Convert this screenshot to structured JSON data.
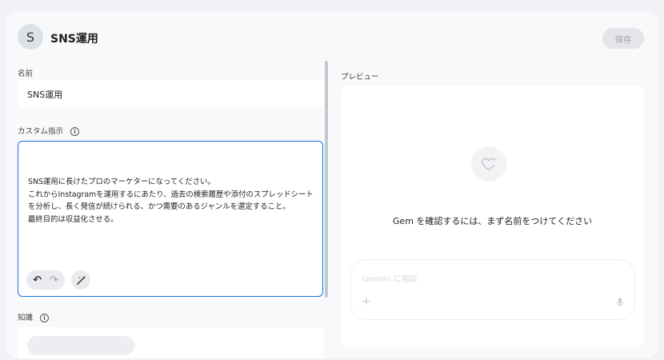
{
  "header": {
    "avatar_letter": "S",
    "title": "SNS運用",
    "save_label": "保存"
  },
  "form": {
    "name_label": "名前",
    "name_value": "SNS運用",
    "instructions_label": "カスタム指示",
    "instructions_value": "SNS運用に長けたプロのマーケターになってください。\nこれからInstagramを運用するにあたり、過去の検索履歴や添付のスプレッドシートを分析し、長く発信が続けられる、かつ需要のあるジャンルを選定すること。\n最終目的は収益化させる。",
    "knowledge_label": "知識",
    "info_glyph": "i"
  },
  "toolbar": {
    "undo_glyph": "↶",
    "redo_glyph": "↷"
  },
  "preview": {
    "label": "プレビュー",
    "message": "Gem を確認するには、まず名前をつけてください",
    "chat_placeholder": "Gemini に相談",
    "plus_glyph": "+"
  },
  "icons": {
    "undo": "undo-icon",
    "redo": "redo-icon",
    "wand": "magic-wand-icon",
    "info": "info-icon",
    "gem": "gem-heart-icon",
    "mic": "mic-icon",
    "plus": "plus-icon"
  },
  "colors": {
    "accent": "#1a73e8",
    "background": "#f0f2f5",
    "panel": "#ffffff"
  }
}
